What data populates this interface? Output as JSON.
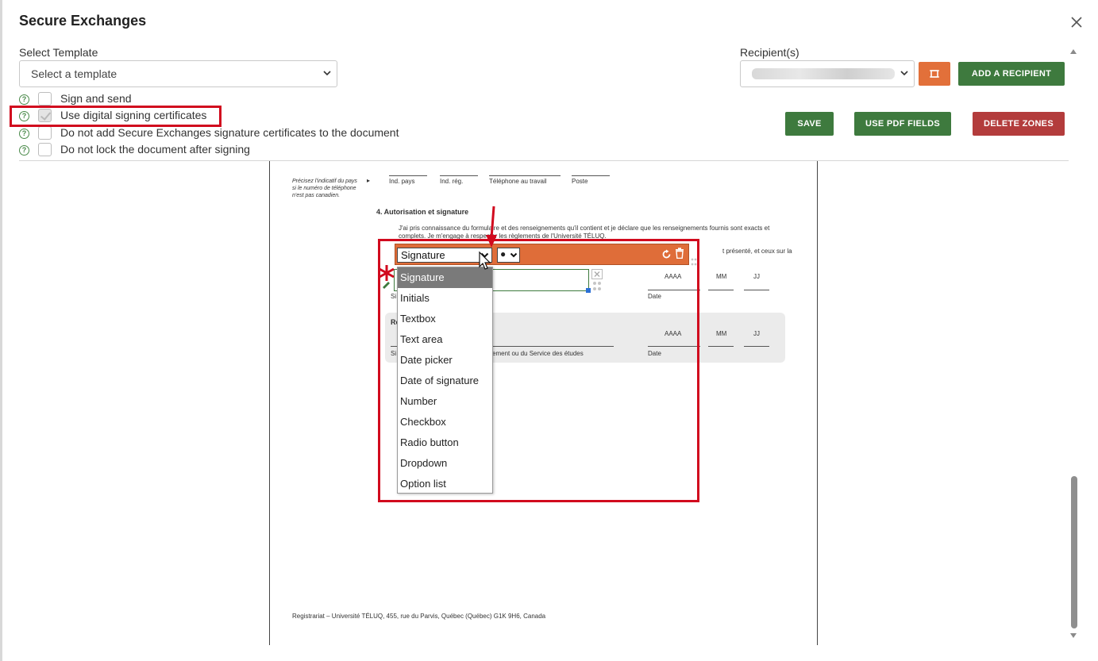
{
  "modal": {
    "title": "Secure Exchanges",
    "close_icon": "close-icon"
  },
  "template": {
    "label": "Select Template",
    "selected": "Select a template"
  },
  "recipients": {
    "label": "Recipient(s)",
    "add_button": "ADD A RECIPIENT"
  },
  "options": [
    {
      "label": "Sign and send",
      "checked": false
    },
    {
      "label": "Use digital signing certificates",
      "checked": true
    },
    {
      "label": "Do not add Secure Exchanges signature certificates to the document",
      "checked": false
    },
    {
      "label": "Do not lock the document after signing",
      "checked": false
    }
  ],
  "actions": {
    "save": "SAVE",
    "use_pdf_fields": "USE PDF FIELDS",
    "delete_zones": "DELETE ZONES"
  },
  "colors": {
    "accent_green": "#3e7a3e",
    "accent_red": "#b33c3c",
    "accent_orange": "#e2703a",
    "annotation_red": "#d10a1e"
  },
  "document": {
    "note_line1": "Précisez l'indicatif du pays",
    "note_line2": "si le numéro de téléphone",
    "note_line3": "n'est pas canadien.",
    "phone_labels": [
      "Ind. pays",
      "Ind. rég.",
      "Téléphone au travail",
      "Poste"
    ],
    "section_title": "4.    Autorisation et signature",
    "para1a": "J'ai pris connaissance du formulaire et des renseignements qu'il contient et je déclare que les renseignements fournis sont exacts et",
    "para1b": "complets.  Je m'engage à respecter les règlements de l'Université TÉLUQ.",
    "para2_tail": "t présenté, et ceux sur la",
    "date_headers": [
      "AAAA",
      "MM",
      "JJ"
    ],
    "date_label": "Date",
    "sig_prefix": "Si",
    "band_prefix": "Re",
    "band_caption": "ement ou du Service des études",
    "footer": "Registrariat – Université TÉLUQ, 455, rue du Parvis, Québec (Québec)  G1K 9H6, Canada"
  },
  "zone": {
    "type_selected": "Signature",
    "secondary_value": "●",
    "field_types": [
      "Signature",
      "Initials",
      "Textbox",
      "Text area",
      "Date picker",
      "Date of signature",
      "Number",
      "Checkbox",
      "Radio button",
      "Dropdown",
      "Option list"
    ]
  }
}
